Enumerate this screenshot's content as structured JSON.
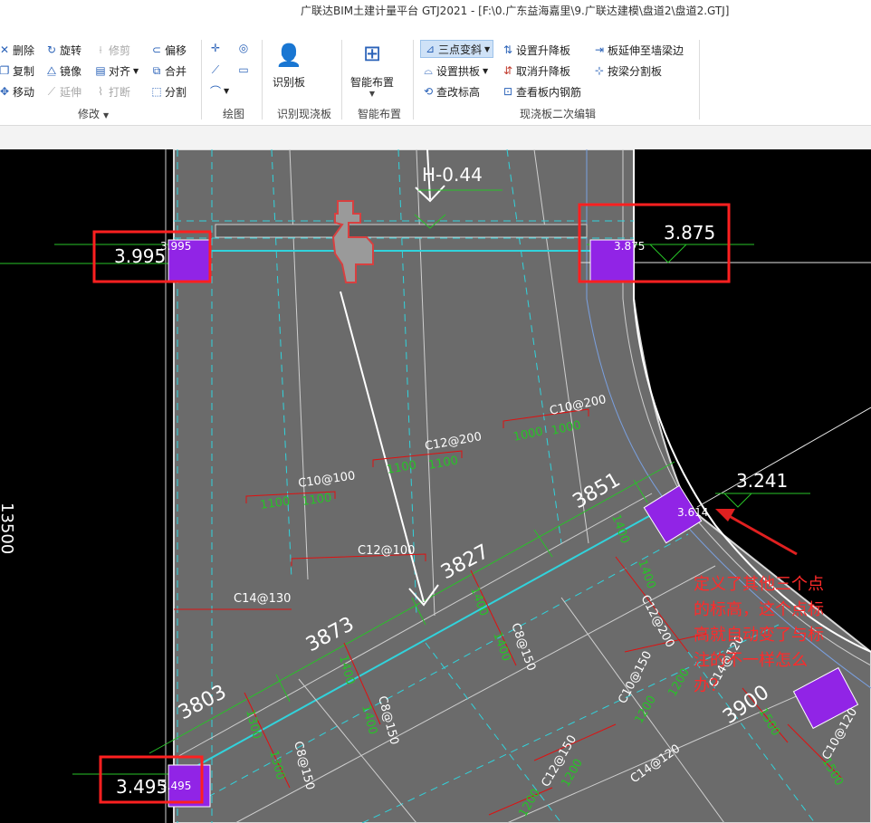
{
  "window": {
    "title": "广联达BIM土建计量平台 GTJ2021 - [F:\\0.广东益海嘉里\\9.广联达建模\\盘道2\\盘道2.GTJ]"
  },
  "ribbon": {
    "modify": {
      "delete": "删除",
      "rotate": "旋转",
      "trim": "修剪",
      "offset": "偏移",
      "copy": "复制",
      "mirror": "镜像",
      "align": "对齐",
      "merge": "合并",
      "move": "移动",
      "extend": "延伸",
      "break": "打断",
      "split": "分割",
      "group": "修改"
    },
    "draw": {
      "group": "绘图"
    },
    "identify": {
      "button": "识别板",
      "group": "识别现浇板"
    },
    "smart": {
      "button": "智能布置",
      "group": "智能布置"
    },
    "edit": {
      "three_point_slope": "三点变斜",
      "set_slope": "设置升降板",
      "extend_to_beam": "板延伸至墙梁边",
      "set_arch": "设置拱板",
      "cancel_slope": "取消升降板",
      "split_by_beam": "按梁分割板",
      "check_elevation": "查改标高",
      "view_rebar": "查看板内钢筋",
      "group": "现浇板二次编辑"
    }
  },
  "canvas": {
    "elevations": {
      "top_left": "3.995",
      "top_left_small": "3.995",
      "top_right": "3.875",
      "top_right_small": "3.875",
      "right": "3.241",
      "right_small": "3.614",
      "bottom_left": "3.495",
      "bottom_left_small": "3.495",
      "top_center": "H-0.44"
    },
    "rebar_labels": [
      "C10@200",
      "C12@200",
      "C10@100",
      "C12@100",
      "C14@130",
      "C12@200",
      "C8@150",
      "C10@150",
      "C8@150",
      "C8@150",
      "C12@150",
      "C14@120",
      "C10@120",
      "C14@120"
    ],
    "lengths": [
      "1000",
      "1000",
      "1100",
      "1100",
      "1100",
      "1100",
      "1400",
      "1400",
      "1400",
      "1400",
      "1400",
      "1400",
      "1300",
      "1300",
      "1200",
      "1200",
      "1200",
      "1200",
      "1500",
      "1500"
    ],
    "dimensions": [
      "3851",
      "3827",
      "3873",
      "3803",
      "3900",
      "13500"
    ],
    "annotation": [
      "定义了其他三个点",
      "的标高，这个点标",
      "高就自动变了与标",
      "注的不一样怎么",
      "办？"
    ]
  },
  "colors": {
    "slab": "#6c6c6c",
    "cyan": "#31d3dc",
    "red": "#e01010",
    "green": "#27c327",
    "purple": "#8a2be2"
  }
}
